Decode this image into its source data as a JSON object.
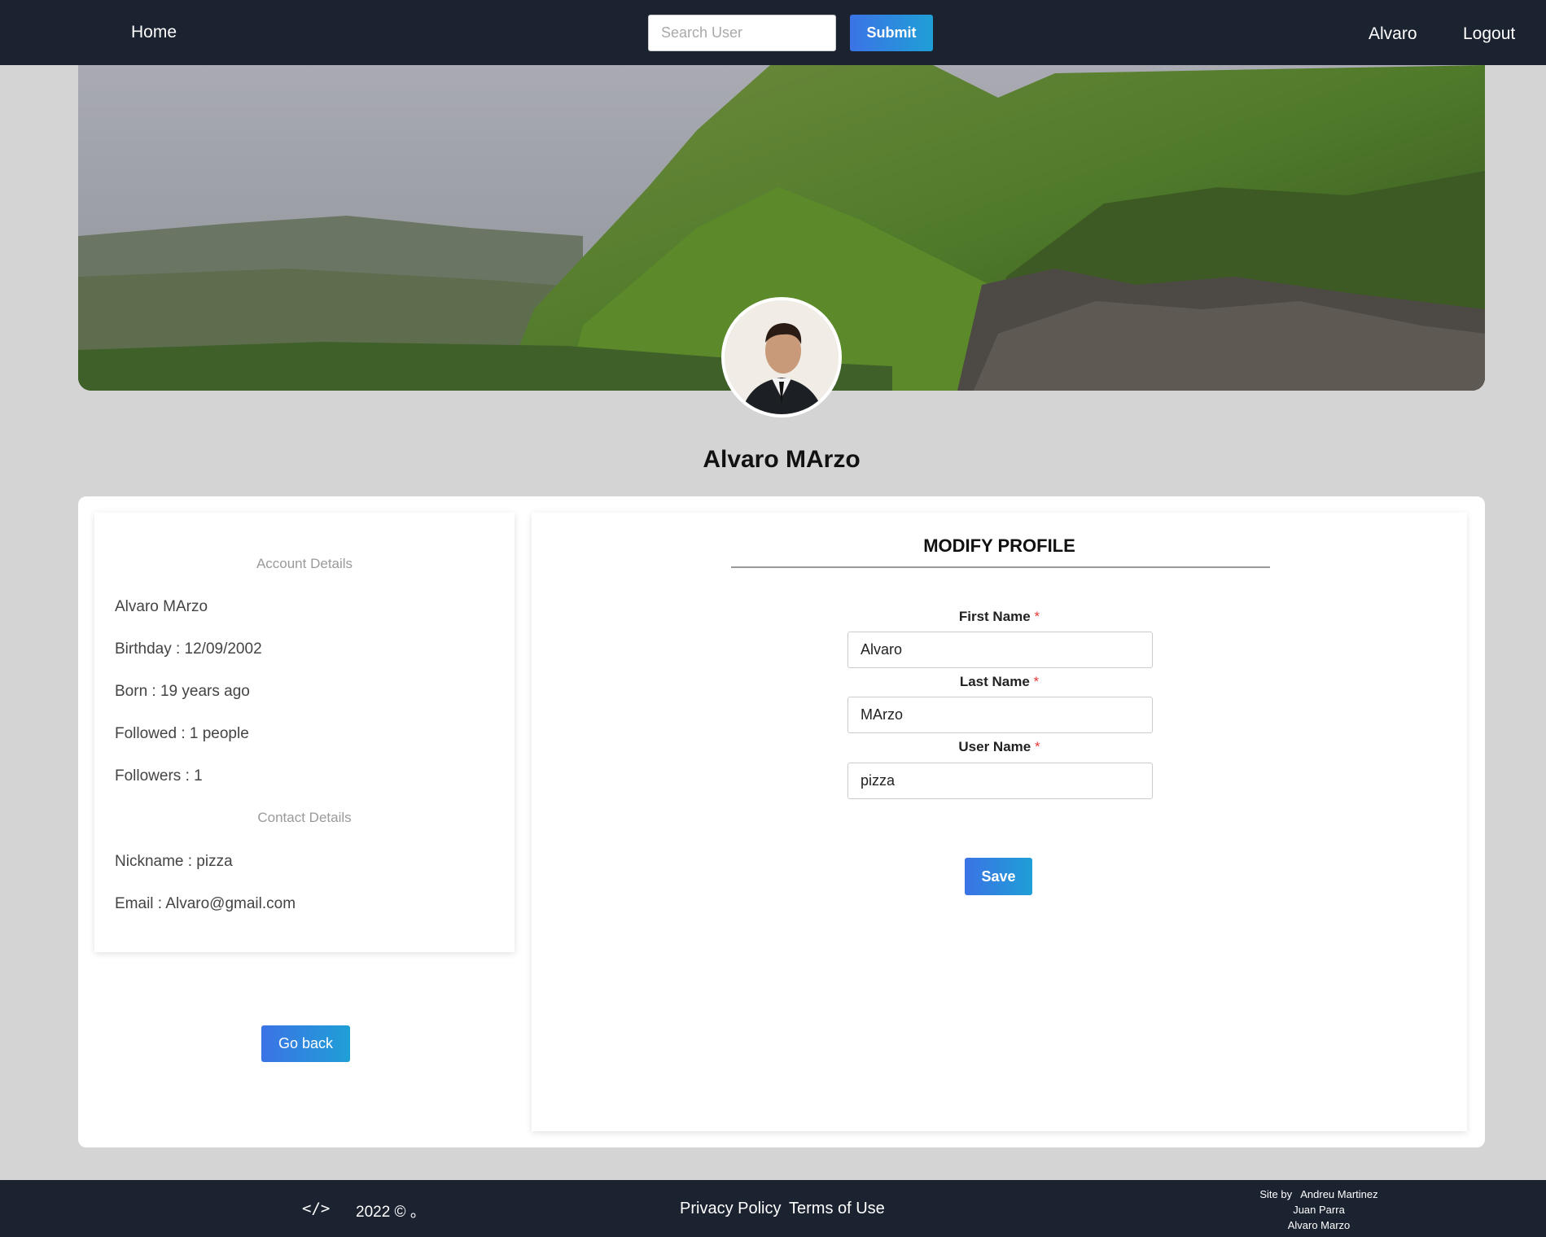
{
  "navbar": {
    "home_label": "Home",
    "search_placeholder": "Search User",
    "submit_label": "Submit",
    "user_label": "Alvaro",
    "logout_label": "Logout"
  },
  "profile": {
    "name": "Alvaro MArzo"
  },
  "account_details": {
    "title": "Account Details",
    "full_name": "Alvaro MArzo",
    "birthday": "Birthday : 12/09/2002",
    "born": "Born : 19 years ago",
    "followed": "Followed : 1 people",
    "followers": "Followers : 1"
  },
  "contact_details": {
    "title": "Contact Details",
    "nickname": "Nickname : pizza",
    "email": "Email : Alvaro@gmail.com"
  },
  "go_back_label": "Go back",
  "modify_profile": {
    "title": "MODIFY PROFILE",
    "required_mark": "*",
    "fields": [
      {
        "label": "First Name",
        "value": "Alvaro"
      },
      {
        "label": "Last Name",
        "value": "MArzo"
      },
      {
        "label": "User Name",
        "value": "pizza"
      }
    ],
    "save_label": "Save"
  },
  "footer": {
    "code_icon": "</>",
    "copyright": "2022 © 。",
    "privacy_label": "Privacy Policy",
    "terms_label": "Terms of Use",
    "credits": [
      "Site by   Andreu Martinez",
      "Juan Parra",
      "Alvaro Marzo"
    ]
  },
  "colors": {
    "navbar": "#1b2230",
    "page_bg": "#d4d4d4",
    "button_gradient_start": "#3b73e6",
    "button_gradient_end": "#1f9fd6",
    "required": "#e53935"
  }
}
